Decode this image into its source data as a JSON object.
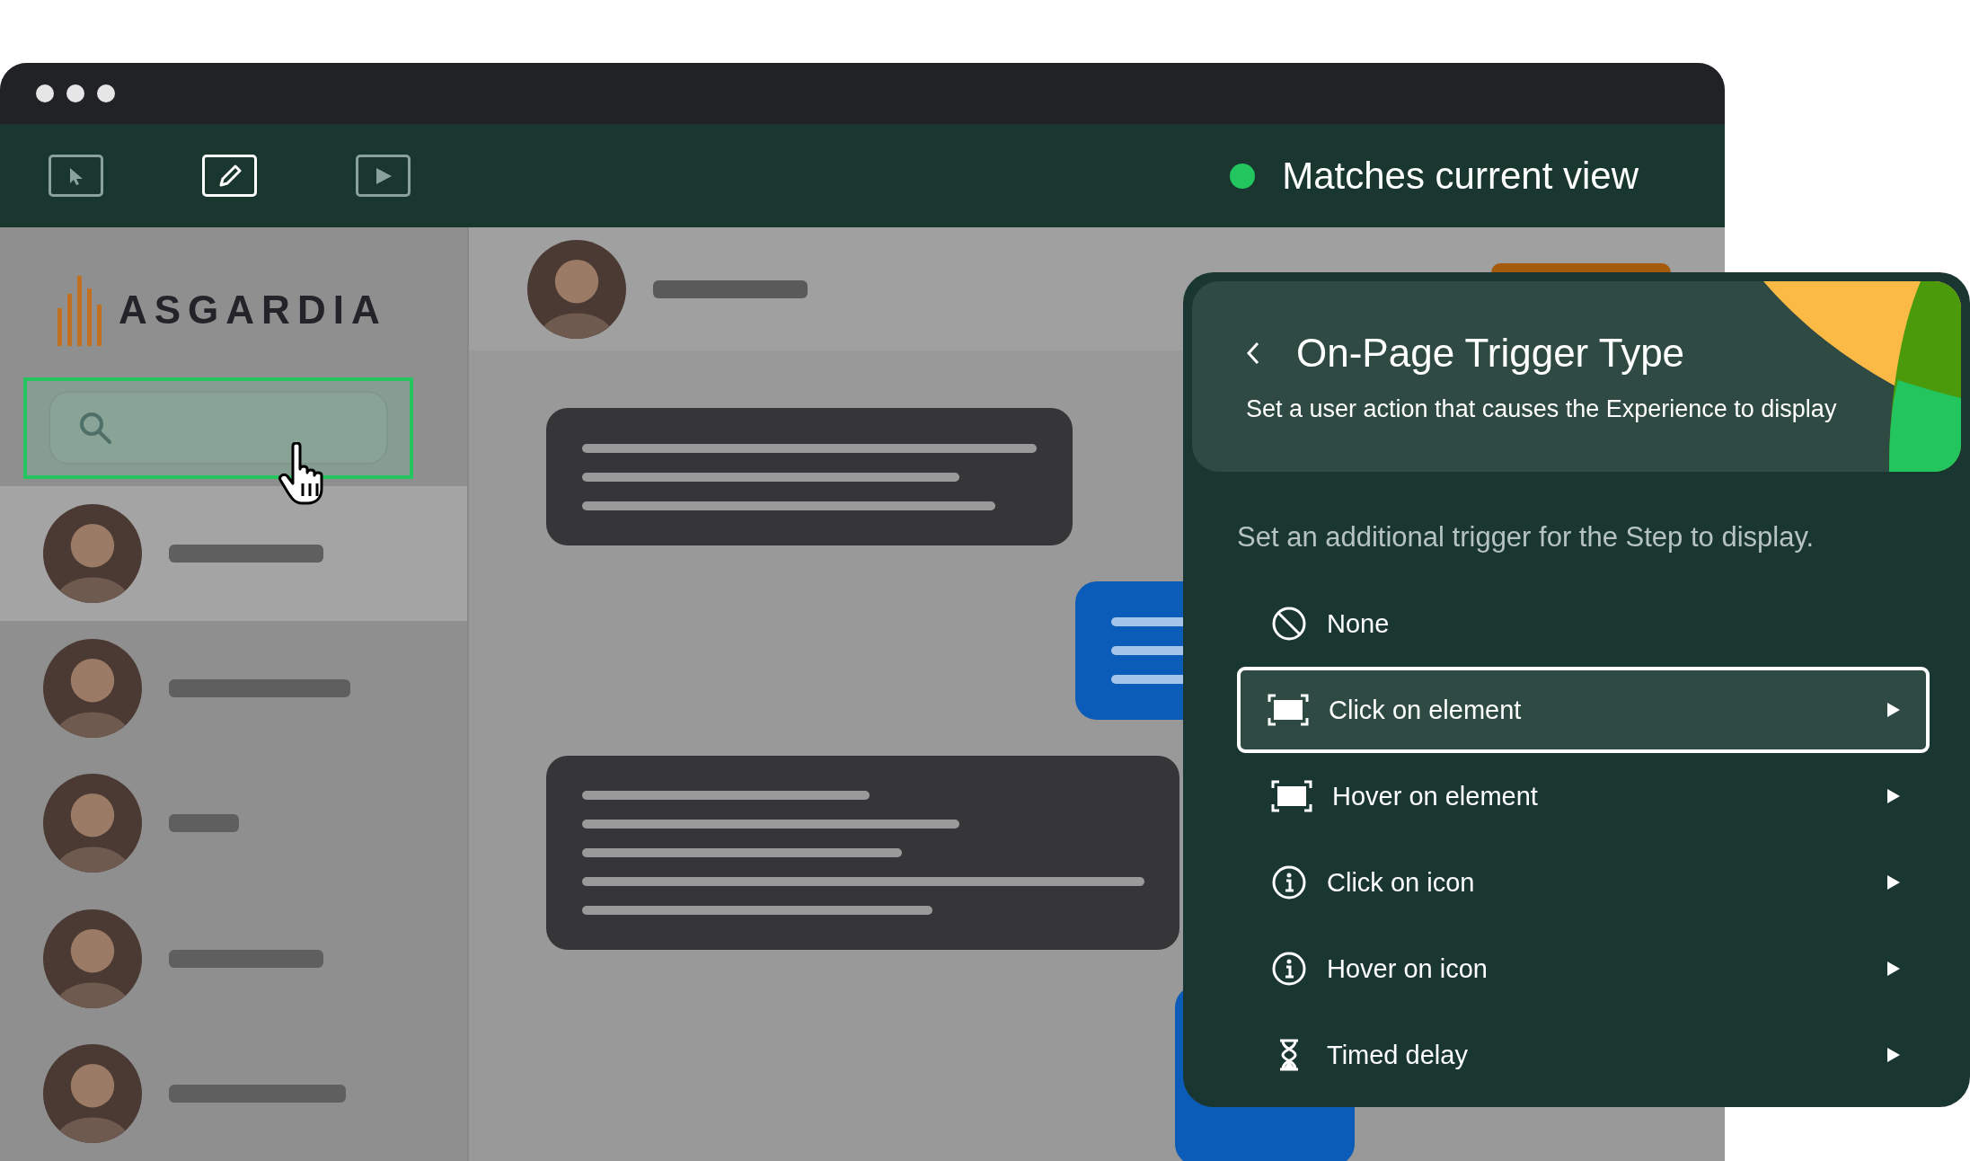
{
  "toolbar": {
    "tools": [
      {
        "kind": "select",
        "selected": false
      },
      {
        "kind": "edit",
        "selected": true
      },
      {
        "kind": "preview",
        "selected": false
      }
    ],
    "status": "Matches current view"
  },
  "sidebar": {
    "logo": "ASGARDIA",
    "search": {
      "highlighted": true
    },
    "contacts": [
      {
        "selected": true
      },
      {
        "selected": false
      },
      {
        "selected": false
      },
      {
        "selected": false
      },
      {
        "selected": false
      }
    ]
  },
  "panel": {
    "title": "On-Page Trigger Type",
    "subtitle": "Set a user action that causes the Experience to display",
    "prompt": "Set an additional trigger for the Step to display.",
    "options": [
      {
        "kind": "none",
        "label": "None",
        "selected": false,
        "submenu": false
      },
      {
        "kind": "element",
        "label": "Click on element",
        "selected": true,
        "submenu": true
      },
      {
        "kind": "element",
        "label": "Hover on element",
        "selected": false,
        "submenu": true
      },
      {
        "kind": "info",
        "label": "Click on icon",
        "selected": false,
        "submenu": true
      },
      {
        "kind": "info",
        "label": "Hover on icon",
        "selected": false,
        "submenu": true
      },
      {
        "kind": "timer",
        "label": "Timed delay",
        "selected": false,
        "submenu": true
      }
    ]
  }
}
